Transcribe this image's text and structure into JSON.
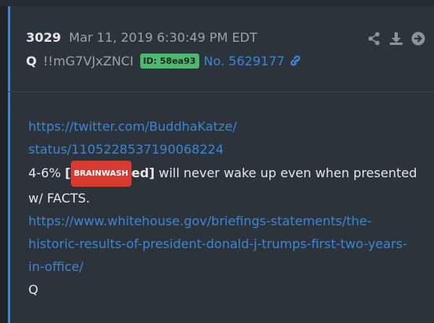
{
  "post": {
    "number": "3029",
    "timestamp": "Mar 11, 2019 6:30:49 PM EDT",
    "author": "Q",
    "tripcode": "!!mG7VJxZNCI",
    "id_badge": "ID: 58ea93",
    "post_link": "No. 5629177"
  },
  "icons": {
    "share": "share-icon",
    "download": "download-icon",
    "go": "arrow-right-circle-icon",
    "link": "link-icon"
  },
  "body": {
    "link1_line1": "https://twitter.com/BuddhaKatze/",
    "link1_line2": "status/1105228537190068224",
    "text_prefix": "4-6% ",
    "bracket_open": "[",
    "badge": "BRAINWASH",
    "bold_suffix": "ed]",
    "text_rest": " will never wake up even when presented",
    "text_line2": "w/ FACTS.",
    "link2_line1": "https://www.whitehouse.gov/briefings-statements/the-",
    "link2_line2": "historic-results-of-president-donald-j-trumps-first-two-years-",
    "link2_line3": "in-office/",
    "signature": "Q"
  },
  "colors": {
    "link": "#3b86d4",
    "badge_green": "#4fb86f",
    "badge_red": "#d83a32"
  }
}
